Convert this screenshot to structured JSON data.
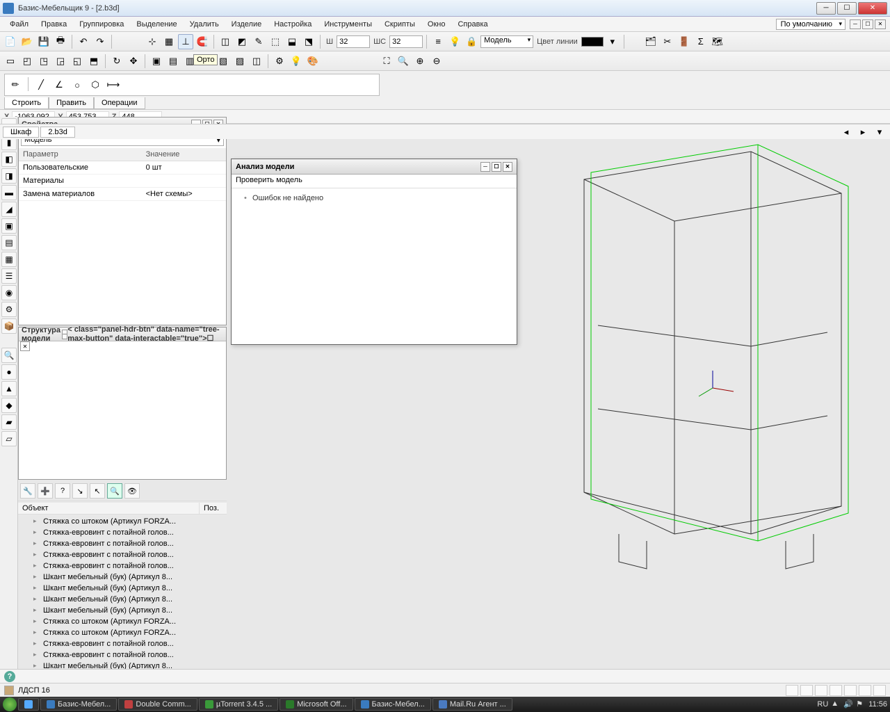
{
  "titlebar": {
    "title": "Базис-Мебельщик 9 - [2.b3d]"
  },
  "menu": [
    "Файл",
    "Правка",
    "Группировка",
    "Выделение",
    "Удалить",
    "Изделие",
    "Настройка",
    "Инструменты",
    "Скрипты",
    "Окно",
    "Справка"
  ],
  "default_mode": "По умолчанию",
  "toolbar2": {
    "w_label": "Ш",
    "w_val": "32",
    "ws_label": "ШС",
    "ws_val": "32",
    "model_label": "Модель",
    "line_color": "Цвет линии"
  },
  "tooltip": "Орто",
  "tabs": {
    "build": "Строить",
    "edit": "Править",
    "ops": "Операции"
  },
  "coords": {
    "x_label": "X",
    "x": "-1063,092",
    "y_label": "Y",
    "y": "453,753",
    "z_label": "Z",
    "z": "448"
  },
  "props_panel": {
    "title": "Свойства",
    "selector": "Модель",
    "col_param": "Параметр",
    "col_val": "Значение",
    "rows": [
      {
        "p": "Пользовательские",
        "v": "0 шт"
      },
      {
        "p": "Материалы",
        "v": ""
      },
      {
        "p": "Замена материалов",
        "v": "<Нет схемы>"
      }
    ]
  },
  "tree_panel": {
    "title": "Структура модели",
    "col_obj": "Объект",
    "col_pos": "Поз.",
    "items": [
      "Стяжка со штоком (Артикул FORZA...",
      "Стяжка-евровинт с потайной голов...",
      "Стяжка-евровинт с потайной голов...",
      "Стяжка-евровинт с потайной голов...",
      "Стяжка-евровинт с потайной голов...",
      "Шкант мебельный (бук) (Артикул 8...",
      "Шкант мебельный (бук) (Артикул 8...",
      "Шкант мебельный (бук) (Артикул 8...",
      "Шкант мебельный (бук) (Артикул 8...",
      "Стяжка со штоком (Артикул FORZA...",
      "Стяжка со штоком (Артикул FORZA...",
      "Стяжка-евровинт с потайной голов...",
      "Стяжка-евровинт с потайной голов...",
      "Шкант мебельный (бук) (Артикул 8..."
    ]
  },
  "dialog": {
    "title": "Анализ модели",
    "menu_check": "Проверить модель",
    "result": "Ошибок не найдено"
  },
  "vp_tabs": {
    "t1": "Шкаф",
    "t2": "2.b3d"
  },
  "status": {
    "material": "ЛДСП 16"
  },
  "taskbar": {
    "items": [
      {
        "label": "Базис-Мебел...",
        "color": "#3a7bbf"
      },
      {
        "label": "Double Comm...",
        "color": "#c04040"
      },
      {
        "label": "µTorrent 3.4.5 ...",
        "color": "#3a9a3a"
      },
      {
        "label": "Microsoft Off...",
        "color": "#2a7a2a"
      },
      {
        "label": "Базис-Мебел...",
        "color": "#3a7bbf"
      },
      {
        "label": "Mail.Ru Агент ...",
        "color": "#4a7ac0"
      }
    ],
    "lang": "RU",
    "time": "11:56"
  }
}
